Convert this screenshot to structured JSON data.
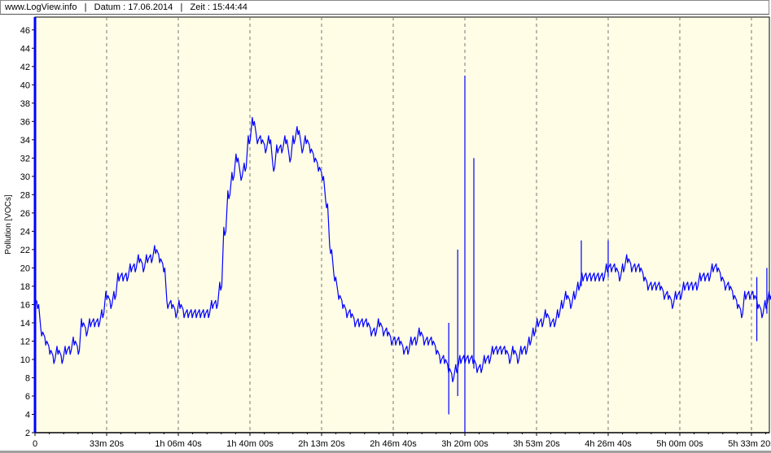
{
  "header": {
    "site": "www.LogView.info",
    "sep": "|",
    "date": "Datum : 17.06.2014",
    "time": "Zeit : 15:44:44"
  },
  "chart_data": {
    "type": "line",
    "title": "",
    "xlabel": "",
    "ylabel": "Pollution [VOCs]",
    "xlim_seconds": [
      0,
      20500
    ],
    "ylim": [
      2,
      47.4
    ],
    "grid": "vertical dashed at major x ticks",
    "background": "#fffde6",
    "line_color": "#0000ff",
    "y_ticks": [
      2,
      4,
      6,
      8,
      10,
      12,
      14,
      16,
      18,
      20,
      22,
      24,
      26,
      28,
      30,
      32,
      34,
      36,
      38,
      40,
      42,
      44,
      46
    ],
    "x_ticks": [
      {
        "seconds": 0,
        "label": "0"
      },
      {
        "seconds": 2000,
        "label": "33m 20s"
      },
      {
        "seconds": 4000,
        "label": "1h 06m 40s"
      },
      {
        "seconds": 6000,
        "label": "1h 40m 00s"
      },
      {
        "seconds": 8000,
        "label": "2h 13m 20s"
      },
      {
        "seconds": 10000,
        "label": "2h 46m 40s"
      },
      {
        "seconds": 12000,
        "label": "3h 20m 00s"
      },
      {
        "seconds": 14000,
        "label": "3h 53m 20s"
      },
      {
        "seconds": 16000,
        "label": "4h 26m 40s"
      },
      {
        "seconds": 18000,
        "label": "5h 00m 00s"
      },
      {
        "seconds": 20000,
        "label": "5h 33m 20s"
      }
    ],
    "series": [
      {
        "name": "Pollution",
        "x_start_seconds": 45,
        "x_step_seconds": 113.6,
        "values": [
          16,
          13,
          12,
          11,
          10,
          11,
          10,
          11,
          11,
          12,
          11,
          14,
          13,
          14,
          14,
          14,
          15,
          17,
          16,
          17,
          19,
          19,
          19,
          20,
          20,
          21,
          20,
          21,
          21,
          22,
          21,
          20,
          16,
          16,
          15,
          16,
          15,
          15,
          15,
          15,
          15,
          15,
          15,
          16,
          16,
          18,
          24,
          28,
          30,
          32,
          30,
          31,
          34,
          36,
          34,
          34,
          33,
          34,
          31,
          33,
          33,
          34,
          32,
          34,
          35,
          33,
          34,
          33,
          32,
          31,
          30,
          27,
          22,
          19,
          17,
          16,
          15,
          15,
          14,
          14,
          14,
          14,
          13,
          13,
          14,
          13,
          13,
          12,
          12,
          12,
          11,
          11,
          12,
          12,
          13,
          12,
          12,
          12,
          11,
          10,
          10,
          9,
          8,
          9,
          10,
          10,
          10,
          10,
          9,
          9,
          10,
          10,
          11,
          11,
          11,
          11,
          10,
          11,
          10,
          11,
          11,
          12,
          13,
          14,
          14,
          15,
          14,
          14,
          15,
          16,
          17,
          16,
          17,
          18,
          19,
          19,
          19,
          19,
          19,
          19,
          20,
          20,
          20,
          19,
          20,
          21,
          20,
          20,
          20,
          19,
          18,
          18,
          18,
          18,
          17,
          17,
          16,
          17,
          17,
          18,
          18,
          18,
          18,
          19,
          19,
          19,
          20,
          20,
          19,
          18,
          18,
          17,
          16,
          15,
          17,
          17,
          17,
          16,
          15,
          16,
          17
        ]
      }
    ],
    "spikes": [
      {
        "seconds": 0,
        "low": 2,
        "high": 47.4
      },
      {
        "seconds": 12000,
        "low": 2,
        "high": 41
      },
      {
        "seconds": 12250,
        "low": 9,
        "high": 32
      },
      {
        "seconds": 11800,
        "low": 6,
        "high": 22
      },
      {
        "seconds": 11550,
        "low": 4,
        "high": 14
      },
      {
        "seconds": 15250,
        "low": 18,
        "high": 23
      },
      {
        "seconds": 16000,
        "low": 19,
        "high": 23
      },
      {
        "seconds": 20150,
        "low": 12,
        "high": 19
      },
      {
        "seconds": 20430,
        "low": 15,
        "high": 20
      }
    ]
  }
}
